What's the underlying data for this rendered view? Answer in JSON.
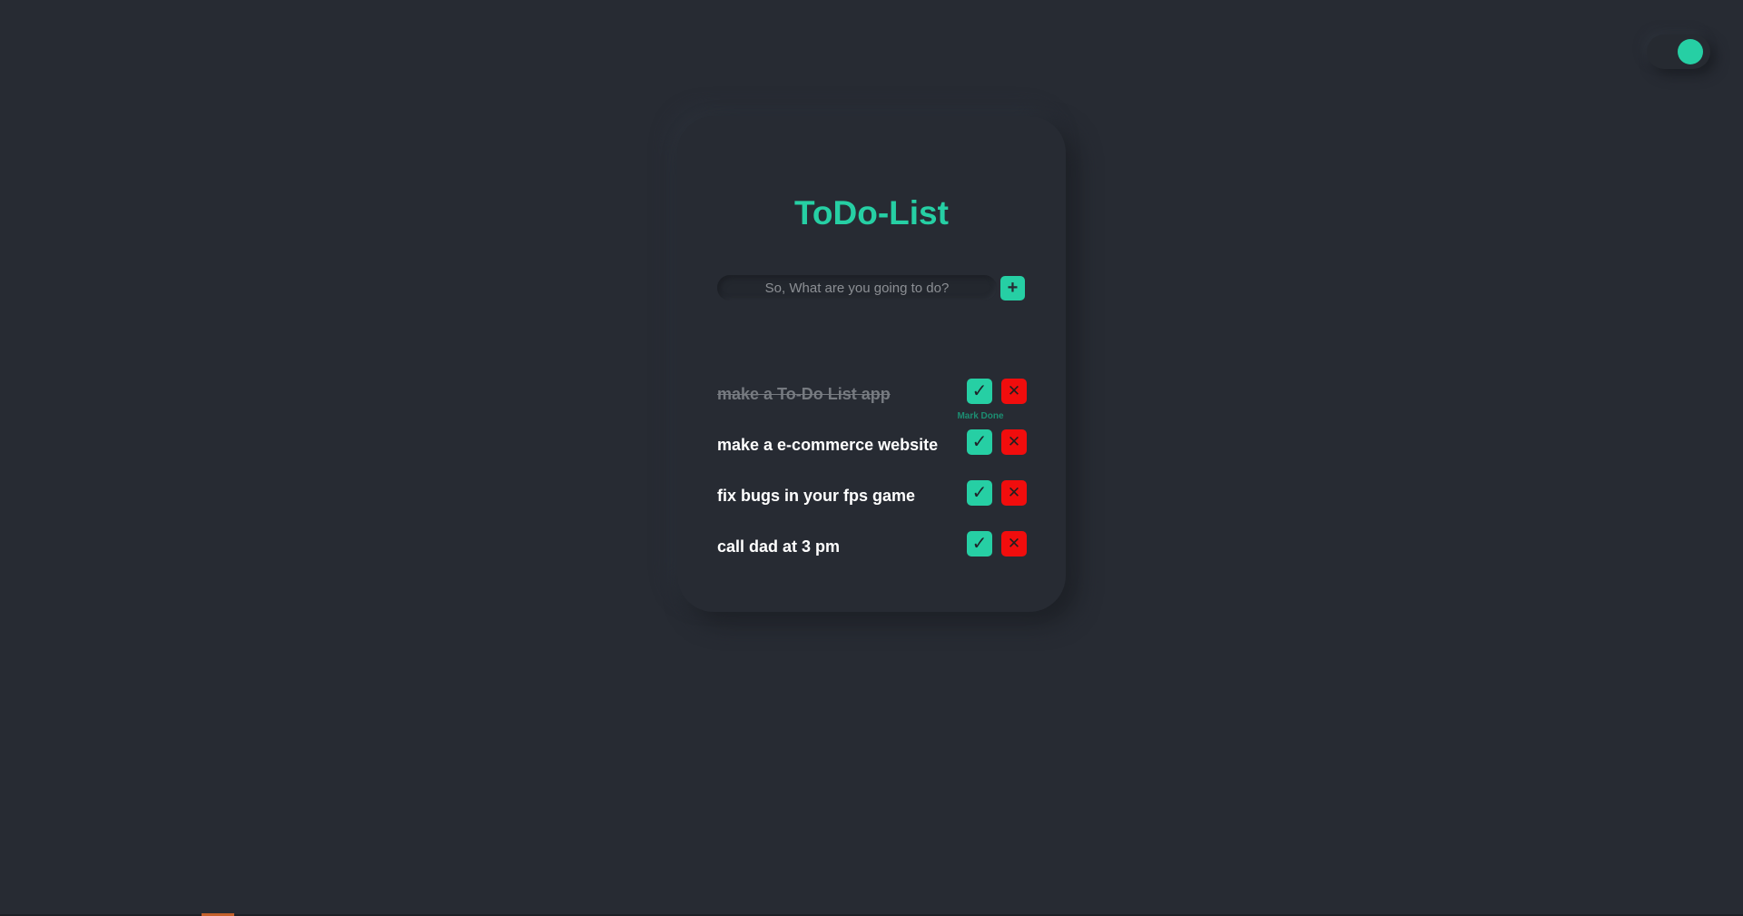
{
  "theme_toggle": {
    "state": "on",
    "accent": "#26cfa4"
  },
  "header": {
    "title": "ToDo-List"
  },
  "new_task": {
    "value": "",
    "placeholder": "So, What are you going to do?",
    "add_icon": "plus-icon",
    "add_label": "+"
  },
  "tasks": [
    {
      "text": "make a To-Do List app",
      "done": true
    },
    {
      "text": "make a e-commerce website",
      "done": false
    },
    {
      "text": "fix bugs in your fps game",
      "done": false
    },
    {
      "text": "call dad at 3 pm",
      "done": false
    }
  ],
  "actions": {
    "done_icon": "check-icon",
    "done_glyph": "✓",
    "delete_icon": "close-icon",
    "delete_glyph": "✕"
  },
  "tooltip": {
    "text": "Mark Done"
  },
  "colors": {
    "background": "#272b33",
    "accent": "#26cfa4",
    "delete": "#f10d0d",
    "text": "#ffffff",
    "done_text": "#767a80"
  }
}
